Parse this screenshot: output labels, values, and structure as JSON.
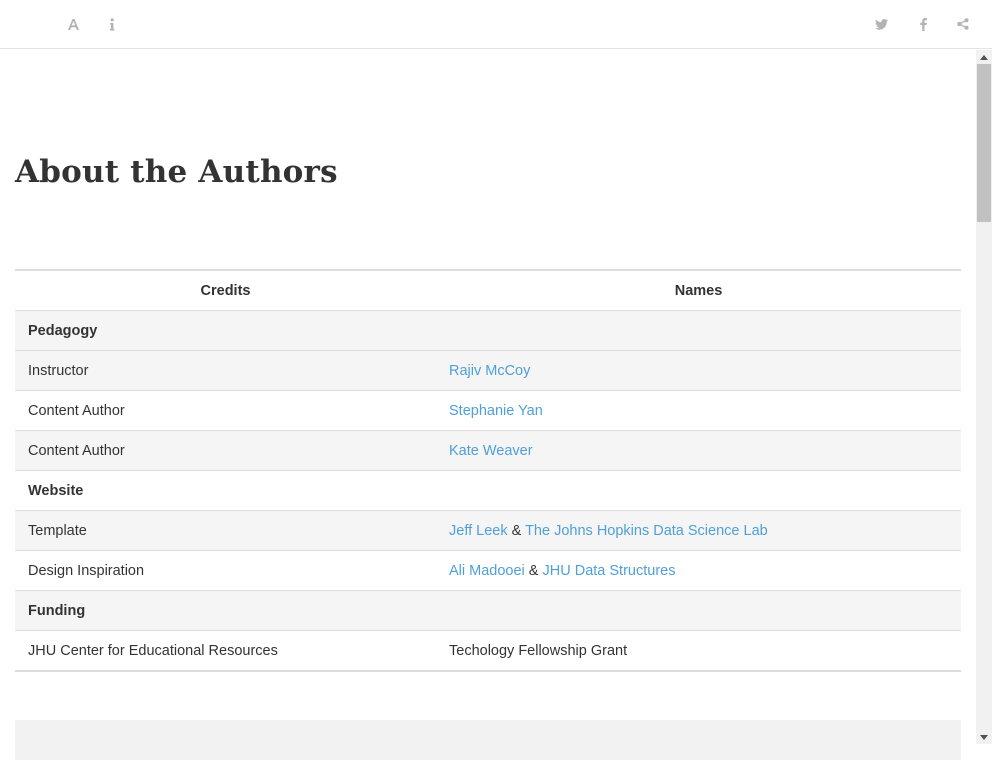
{
  "page": {
    "title": "About the Authors"
  },
  "toolbar": {
    "icons": {
      "font": "font-settings-icon",
      "info": "info-icon",
      "twitter": "twitter-icon",
      "facebook": "facebook-icon",
      "share": "share-icon"
    },
    "icon_color": "#b3b3b3"
  },
  "table": {
    "headers": {
      "credits": "Credits",
      "names": "Names"
    },
    "rows": [
      {
        "type": "section",
        "credit": "Pedagogy"
      },
      {
        "type": "person",
        "credit": "Instructor",
        "link1": "Rajiv McCoy"
      },
      {
        "type": "person",
        "credit": "Content Author",
        "link1": "Stephanie Yan"
      },
      {
        "type": "person",
        "credit": "Content Author",
        "link1": "Kate Weaver"
      },
      {
        "type": "section",
        "credit": "Website"
      },
      {
        "type": "pair",
        "credit": "Template",
        "link1": "Jeff Leek",
        "joiner": "&",
        "link2": "The Johns Hopkins Data Science Lab"
      },
      {
        "type": "pair",
        "credit": "Design Inspiration",
        "link1": "Ali Madooei",
        "joiner": "&",
        "link2": "JHU Data Structures"
      },
      {
        "type": "section",
        "credit": "Funding"
      },
      {
        "type": "plain",
        "credit": "JHU Center for Educational Resources",
        "name": "Techology Fellowship Grant"
      }
    ]
  },
  "colors": {
    "link": "#4f9fd9",
    "stripe": "#f5f5f5",
    "border": "#dddddd",
    "text": "#333333"
  }
}
